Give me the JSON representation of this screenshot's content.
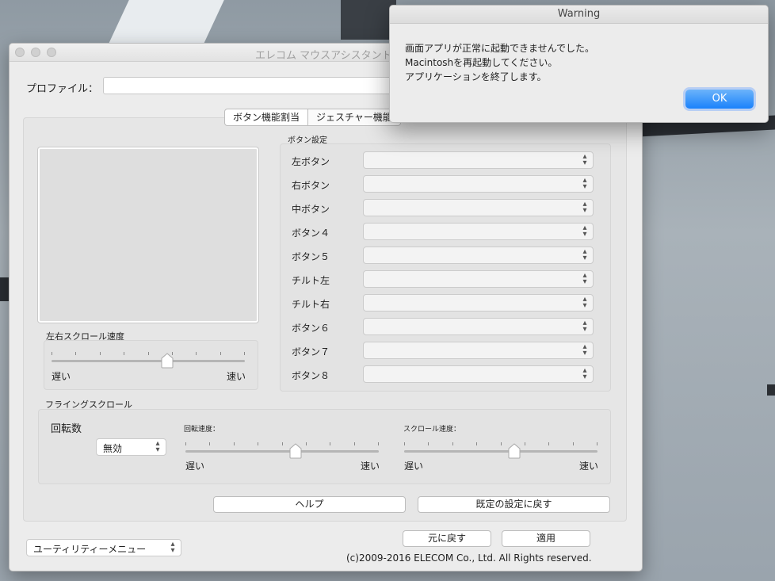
{
  "main_window": {
    "title": "エレコム マウスアシスタント５",
    "profile_label": "プロファイル：",
    "profile_value": "",
    "tabs": [
      {
        "label": "ボタン機能割当"
      },
      {
        "label": "ジェスチャー機能"
      }
    ],
    "horizontal_scroll": {
      "label": "左右スクロール速度",
      "min_label": "遅い",
      "max_label": "速い",
      "level": 0.6
    },
    "button_settings": {
      "header": "ボタン設定",
      "rows": [
        {
          "label": "左ボタン",
          "value": ""
        },
        {
          "label": "右ボタン",
          "value": ""
        },
        {
          "label": "中ボタン",
          "value": ""
        },
        {
          "label": "ボタン４",
          "value": ""
        },
        {
          "label": "ボタン５",
          "value": ""
        },
        {
          "label": "チルト左",
          "value": ""
        },
        {
          "label": "チルト右",
          "value": ""
        },
        {
          "label": "ボタン６",
          "value": ""
        },
        {
          "label": "ボタン７",
          "value": ""
        },
        {
          "label": "ボタン８",
          "value": ""
        }
      ]
    },
    "flying_scroll": {
      "header": "フライングスクロール",
      "rotation_label": "回転数",
      "rotation_value": "無効",
      "rotation_speed": {
        "label": "回転速度：",
        "min_label": "遅い",
        "max_label": "速い",
        "level": 0.57
      },
      "scroll_speed": {
        "label": "スクロール速度：",
        "min_label": "遅い",
        "max_label": "速い",
        "level": 0.57
      }
    },
    "help_button": "ヘルプ",
    "reset_defaults_button": "既定の設定に戻す",
    "revert_button": "元に戻す",
    "apply_button": "適用",
    "utility_menu": "ユーティリティーメニュー",
    "copyright": "(c)2009-2016 ELECOM Co., Ltd. All Rights reserved."
  },
  "warning_dialog": {
    "title": "Warning",
    "messages": [
      "画面アプリが正常に起動できませんでした。",
      "Macintoshを再起動してください。",
      "アプリケーションを終了します。"
    ],
    "ok_label": "OK"
  }
}
